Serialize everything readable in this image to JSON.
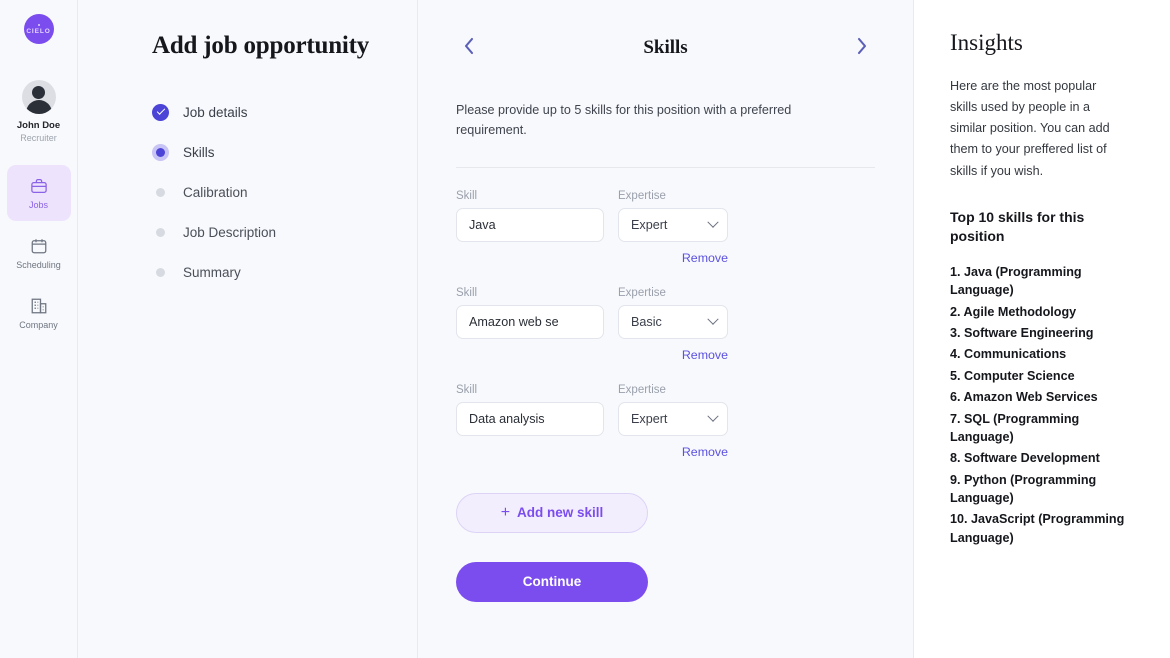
{
  "rail": {
    "logo_text": "CIELO",
    "user": {
      "name": "John Doe",
      "role": "Recruiter"
    },
    "nav": [
      {
        "label": "Jobs",
        "icon": "briefcase-icon",
        "active": true
      },
      {
        "label": "Scheduling",
        "icon": "calendar-icon",
        "active": false
      },
      {
        "label": "Company",
        "icon": "building-icon",
        "active": false
      }
    ]
  },
  "steps": {
    "title": "Add job opportunity",
    "items": [
      {
        "label": "Job details",
        "state": "done"
      },
      {
        "label": "Skills",
        "state": "current"
      },
      {
        "label": "Calibration",
        "state": "todo"
      },
      {
        "label": "Job Description",
        "state": "todo"
      },
      {
        "label": "Summary",
        "state": "todo"
      }
    ]
  },
  "center": {
    "title": "Skills",
    "prev_icon": "chevron-left-icon",
    "next_icon": "chevron-right-icon",
    "description": "Please provide up to 5 skills for this position with a preferred requirement.",
    "skill_label": "Skill",
    "expertise_label": "Expertise",
    "remove_label": "Remove",
    "skill_placeholder": "Skill",
    "rows": [
      {
        "skill": "Java",
        "expertise": "Expert"
      },
      {
        "skill": "Amazon web se",
        "expertise": "Basic"
      },
      {
        "skill": "Data analysis",
        "expertise": "Expert"
      }
    ],
    "add_label": "Add new skill",
    "add_icon": "plus-icon",
    "continue_label": "Continue"
  },
  "insights": {
    "title": "Insights",
    "note": "Here are the most popular skills used by people in a similar position. You can add them to your preffered list of skills if you wish.",
    "subtitle": "Top 10 skills for this position",
    "skills": [
      "1. Java (Programming Language)",
      "2. Agile Methodology",
      "3. Software Engineering",
      "4. Communications",
      "5. Computer Science",
      "6. Amazon Web Services",
      "7. SQL (Programming Language)",
      "8. Software Development",
      "9. Python (Programming Language)",
      "10. JavaScript (Programming Language)"
    ]
  },
  "colors": {
    "brand_purple": "#7b4cee",
    "indigo": "#4b44d6",
    "link": "#5b51e0",
    "panel_bg": "#f8f9fc"
  }
}
